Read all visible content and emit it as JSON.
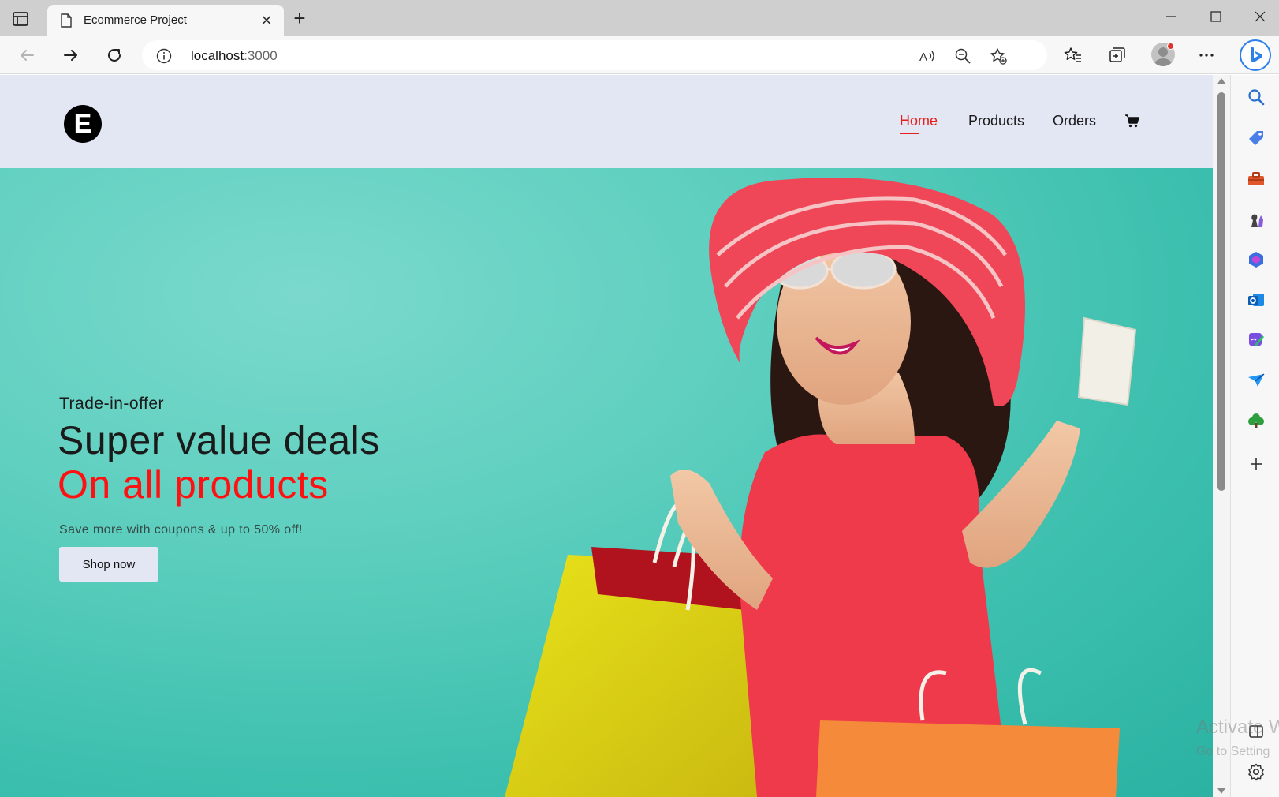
{
  "browser": {
    "tab_title": "Ecommerce Project",
    "url_host": "localhost",
    "url_port": ":3000",
    "accent_color": "#2c80e8"
  },
  "site": {
    "logo_letter": "E",
    "nav": {
      "home": "Home",
      "products": "Products",
      "orders": "Orders"
    },
    "header_bg": "#e3e6f3",
    "active_color": "#e8201c"
  },
  "hero": {
    "eyebrow": "Trade-in-offer",
    "title": "Super value deals",
    "title_accent": "On all products",
    "subtitle": "Save more with coupons & up to 50% off!",
    "cta_label": "Shop now",
    "background": "#5ecfbf"
  },
  "os_watermark": {
    "title": "Activate W",
    "subtitle": "Go to Setting"
  },
  "icons": {
    "side_panel": [
      "search-icon",
      "shopping-tag-icon",
      "toolbox-icon",
      "games-icon",
      "office-icon",
      "outlook-icon",
      "designer-icon",
      "send-icon",
      "tree-icon",
      "add-icon",
      "sidebar-toggle-icon",
      "settings-icon"
    ]
  }
}
